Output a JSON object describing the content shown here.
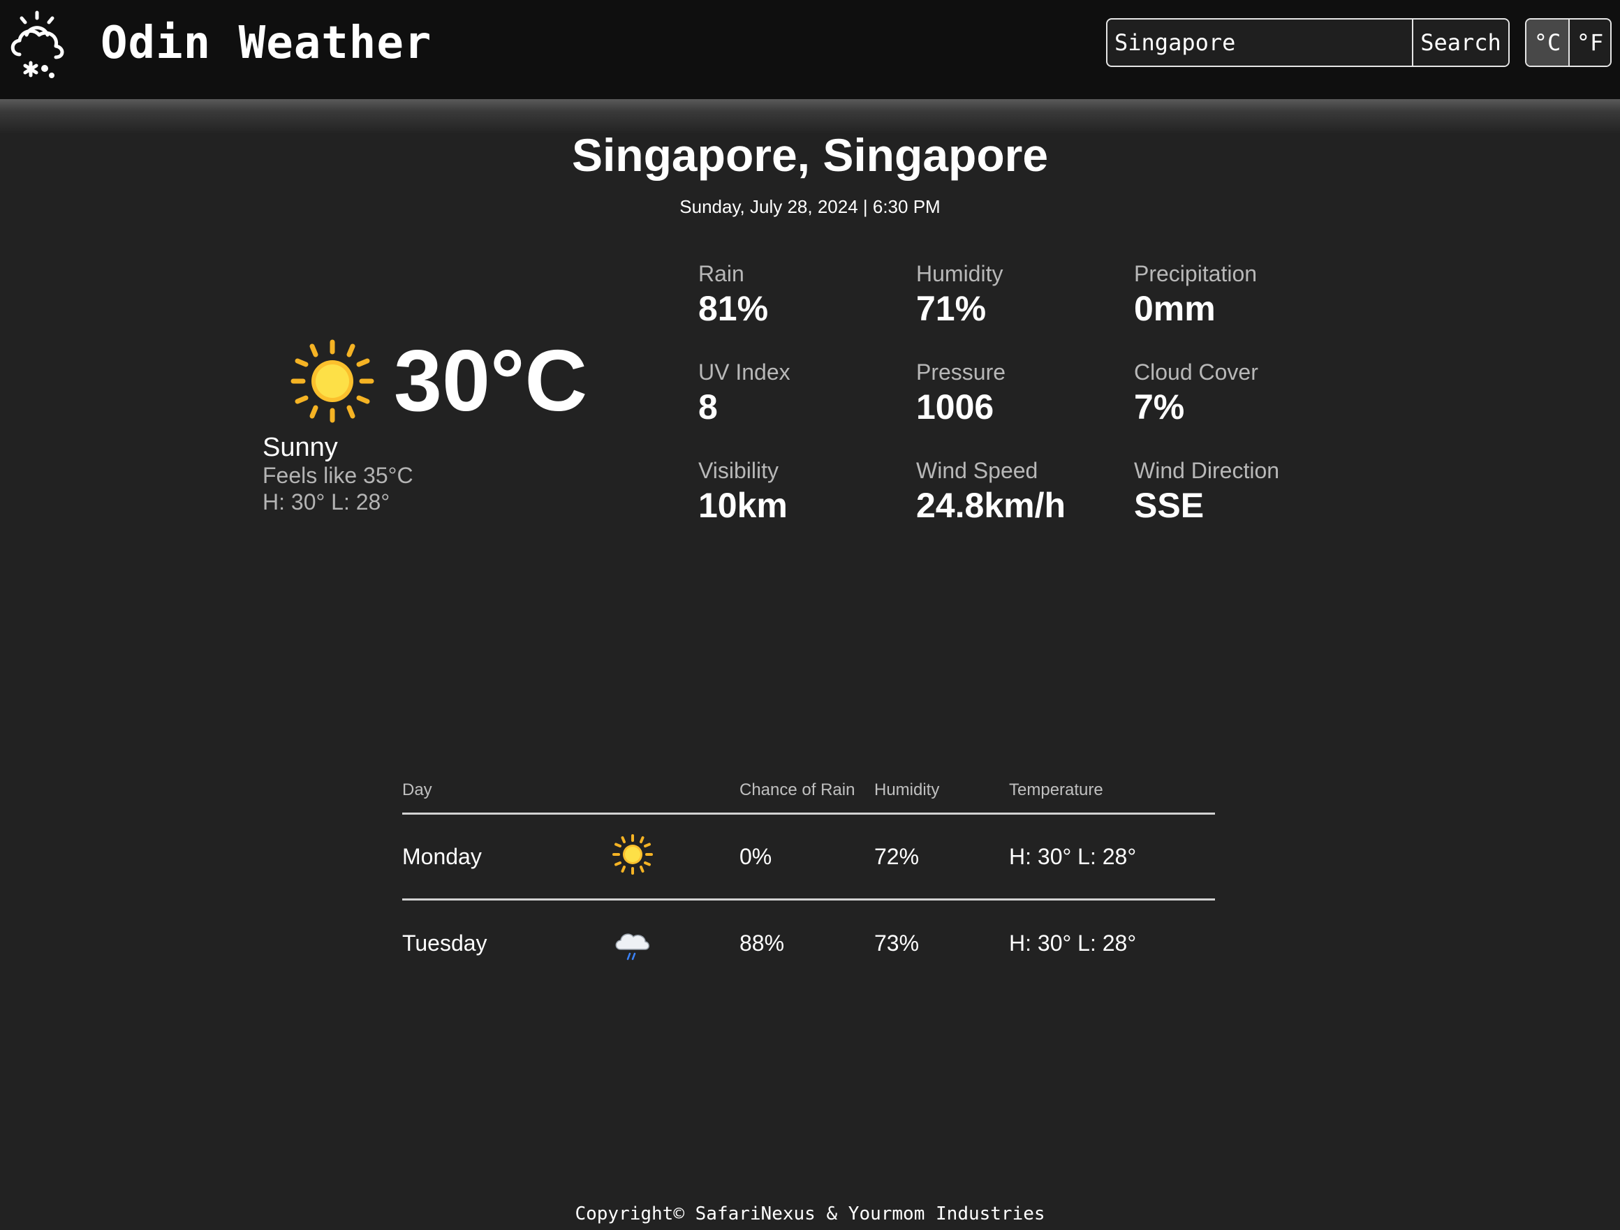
{
  "header": {
    "app_title": "Odin Weather",
    "search": {
      "value": "Singapore",
      "button_label": "Search"
    },
    "units": {
      "celsius_label": "°C",
      "fahrenheit_label": "°F",
      "selected": "celsius"
    }
  },
  "current": {
    "location": "Singapore, Singapore",
    "datetime": "Sunday, July 28, 2024 | 6:30 PM",
    "temperature": "30°C",
    "icon": "sun-icon",
    "condition": "Sunny",
    "feels_like": "Feels like 35°C",
    "hilo": "H: 30° L: 28°",
    "stats": [
      {
        "label": "Rain",
        "value": "81%"
      },
      {
        "label": "Humidity",
        "value": "71%"
      },
      {
        "label": "Precipitation",
        "value": "0mm"
      },
      {
        "label": "UV Index",
        "value": "8"
      },
      {
        "label": "Pressure",
        "value": "1006"
      },
      {
        "label": "Cloud Cover",
        "value": "7%"
      },
      {
        "label": "Visibility",
        "value": "10km"
      },
      {
        "label": "Wind Speed",
        "value": "24.8km/h"
      },
      {
        "label": "Wind Direction",
        "value": "SSE"
      }
    ]
  },
  "forecast": {
    "headers": {
      "day": "Day",
      "rain": "Chance of Rain",
      "humidity": "Humidity",
      "temperature": "Temperature"
    },
    "rows": [
      {
        "day": "Monday",
        "icon": "sun-icon",
        "rain": "0%",
        "humidity": "72%",
        "temperature": "H: 30° L: 28°"
      },
      {
        "day": "Tuesday",
        "icon": "rain-cloud-icon",
        "rain": "88%",
        "humidity": "73%",
        "temperature": "H: 30° L: 28°"
      }
    ]
  },
  "footer": {
    "copyright": "Copyright© SafariNexus & Yourmom Industries"
  },
  "colors": {
    "background": "#222222",
    "topbar": "#0f0f0f",
    "sun": "#fbbf24",
    "rain": "#3b82f6",
    "muted_text": "#b4b4b4"
  }
}
